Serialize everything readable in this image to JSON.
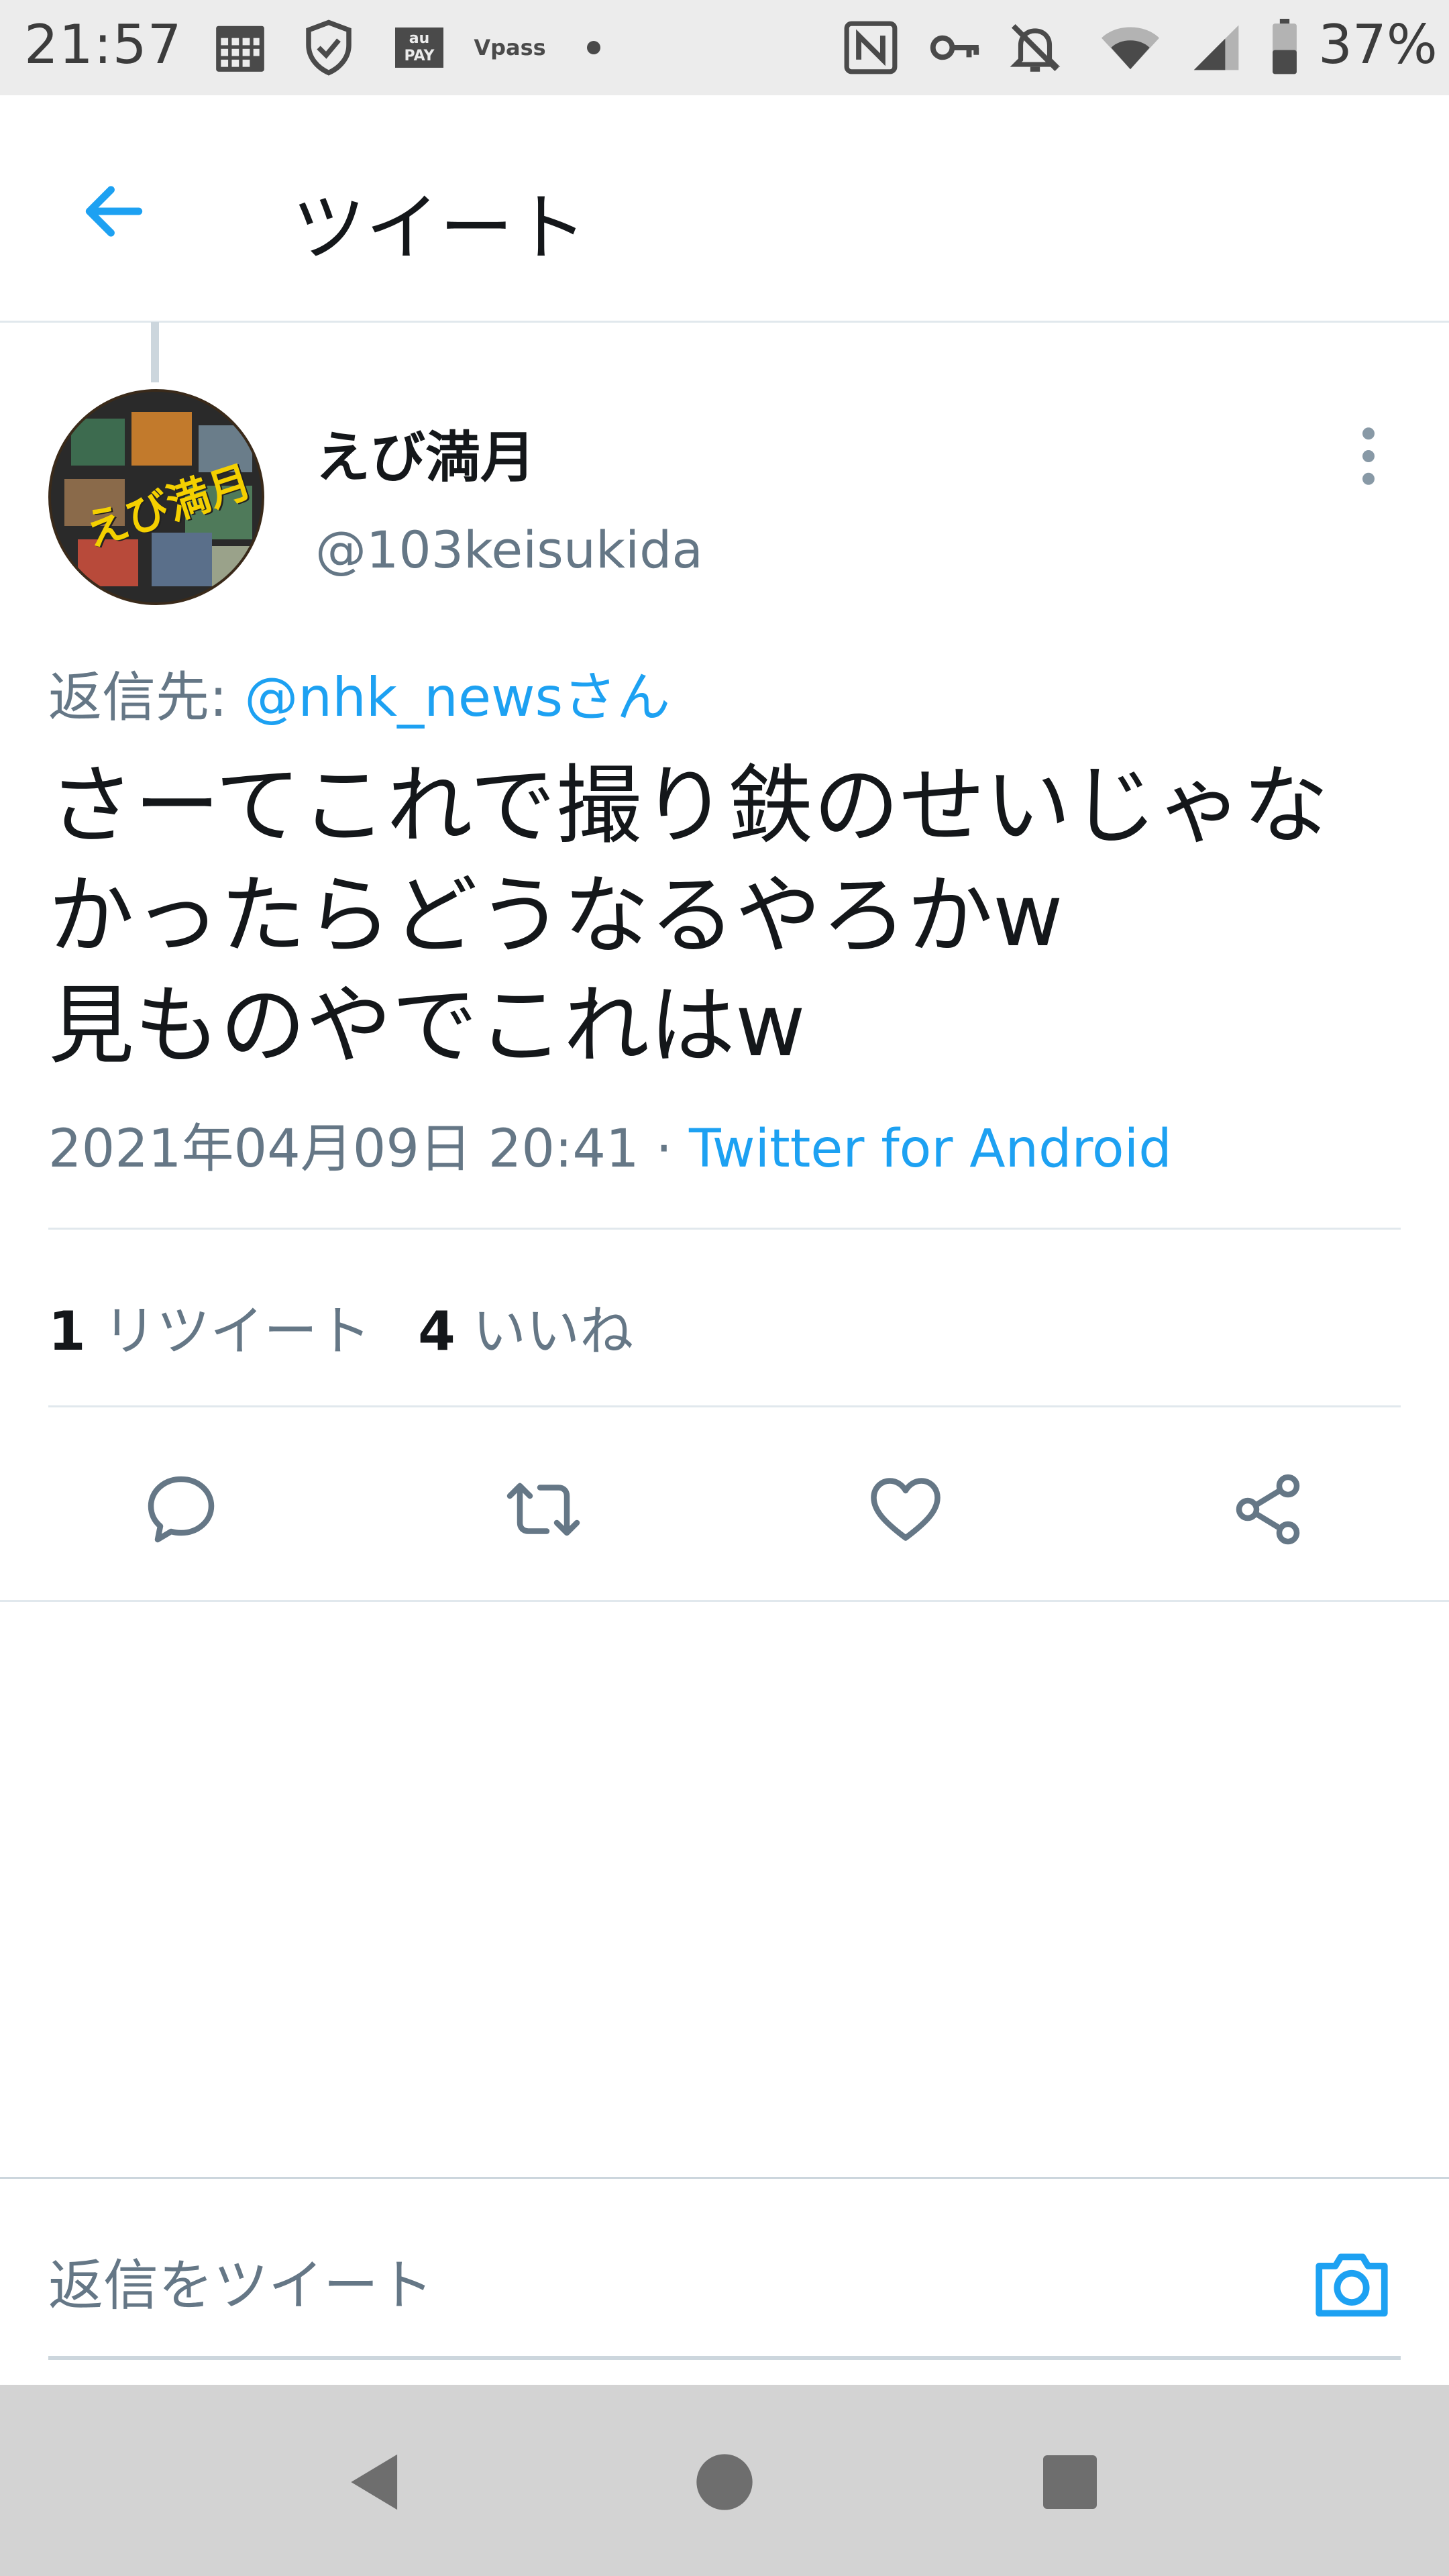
{
  "status_bar": {
    "time": "21:57",
    "battery_percent": "37%",
    "icons": [
      "calendar-icon",
      "shield-check-icon",
      "au-pay-icon",
      "vpass-icon",
      "dot-icon",
      "nfc-icon",
      "key-icon",
      "bell-off-icon",
      "wifi-icon",
      "signal-icon",
      "battery-icon"
    ],
    "au_pay_text": "au PAY",
    "vpass_text": "Vpass"
  },
  "header": {
    "title": "ツイート"
  },
  "tweet": {
    "author_name": "えび満月",
    "author_handle": "@103keisukida",
    "avatar_text": "えび満月",
    "reply_prefix": "返信先: ",
    "reply_mention": "@nhk_newsさん",
    "text_lines": [
      "さーてこれで撮り鉄のせいじゃな",
      "かったらどうなるやろかw",
      "見ものやでこれはw"
    ],
    "timestamp": "2021年04月09日 20:41",
    "separator": " · ",
    "source": "Twitter for Android"
  },
  "stats": {
    "retweet_count": "1",
    "retweet_label": "リツイート",
    "like_count": "4",
    "like_label": "いいね"
  },
  "compose": {
    "placeholder": "返信をツイート"
  },
  "colors": {
    "accent": "#1da1f2",
    "secondary_text": "#657786",
    "primary_text": "#14171a",
    "divider": "#e1e8ed"
  }
}
